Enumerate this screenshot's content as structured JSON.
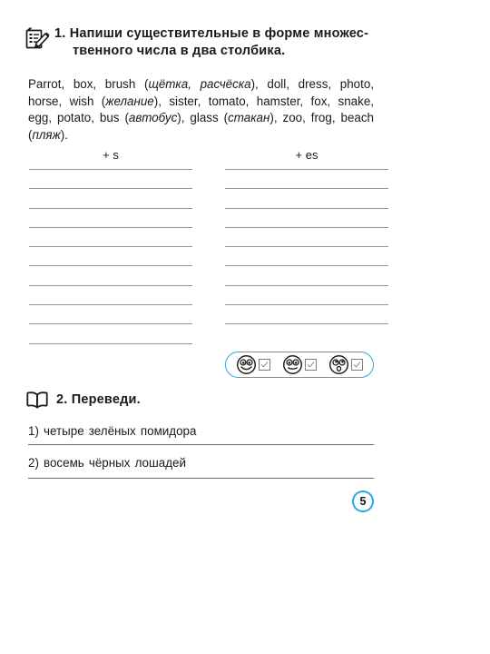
{
  "exercise1": {
    "number": "1.",
    "icon": "notepad-pencil-icon",
    "title_line1": "1. Напиши существительные в форме множес-",
    "title_line2": "твенного числа в два столбика.",
    "wordlist_html": "Parrot, box, brush (<i>щётка, расчёска</i>), doll, dress, photo, horse, wish (<i>желание</i>), sister, tomato, hamster, fox, snake, egg, potato, bus (<i>автобус</i>), glass (<i>стакан</i>), zoo, frog, beach (<i>пляж</i>).",
    "column_left_header": "+ s",
    "column_right_header": "+ es",
    "left_line_count": 10,
    "right_line_count": 9
  },
  "rating": {
    "border_color": "#29abe2",
    "items": [
      {
        "face": "happy-face-icon",
        "checkbox": "checkbox-happy",
        "checked": true
      },
      {
        "face": "neutral-face-icon",
        "checkbox": "checkbox-neutral",
        "checked": true
      },
      {
        "face": "sad-face-icon",
        "checkbox": "checkbox-sad",
        "checked": true
      }
    ]
  },
  "exercise2": {
    "icon": "open-book-icon",
    "title": "2. Переведи.",
    "items": [
      "1) четыре зелёных помидора",
      "2) восемь чёрных лошадей"
    ]
  },
  "footer": {
    "page_number": "5",
    "accent_color": "#29abe2"
  }
}
